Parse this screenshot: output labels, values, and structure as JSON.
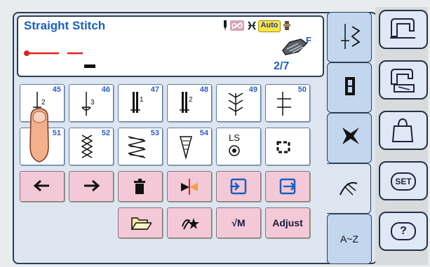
{
  "display": {
    "stitch_name": "Straight Stitch",
    "auto_label": "Auto",
    "presser_foot": "F",
    "page": "2/7"
  },
  "stitches": [
    {
      "number": "45",
      "icon": "bartack-stitch-icon"
    },
    {
      "number": "46",
      "icon": "bartack-stitch-icon"
    },
    {
      "number": "47",
      "icon": "buttonhole-stitch-icon"
    },
    {
      "number": "48",
      "icon": "buttonhole-stitch-icon"
    },
    {
      "number": "49",
      "icon": "feather-stitch-icon"
    },
    {
      "number": "50",
      "icon": "cross-stitch-icon"
    },
    {
      "number": "51",
      "icon": "eyelet-stitch-icon"
    },
    {
      "number": "52",
      "icon": "smocking-stitch-icon"
    },
    {
      "number": "53",
      "icon": "zigzag-stitch-icon"
    },
    {
      "number": "54",
      "icon": "arrow-stitch-icon"
    },
    {
      "number": "",
      "icon": "ls-stitch-icon",
      "label": "LS"
    },
    {
      "number": "",
      "icon": "square-stitch-icon"
    }
  ],
  "controls": {
    "memory_label": "√M",
    "adjust_label": "Adjust"
  },
  "tabs": {
    "alphabet_label": "A~Z"
  },
  "side_buttons": {
    "set_label": "SET",
    "help_label": "?"
  },
  "colors": {
    "text_blue": "#1b5fc0",
    "button_pink": "#f4c9d7",
    "tab_blue": "#c2d6ee",
    "stitch_red": "#e0231d",
    "auto_yellow": "#f7e64a"
  }
}
